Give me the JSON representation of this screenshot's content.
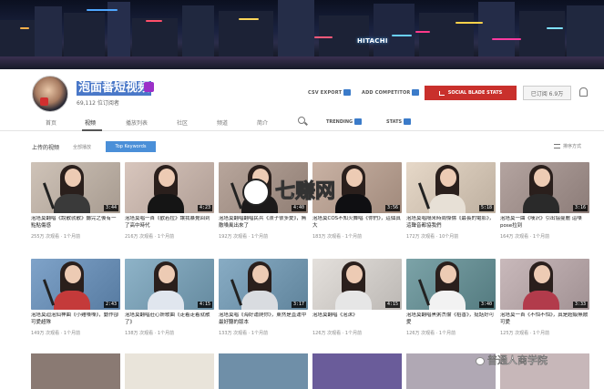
{
  "channel": {
    "name": "泡面番短视频",
    "subscribers": "69,112 位订阅者"
  },
  "header": {
    "csv_export": "CSV EXPORT",
    "add_competitor": "ADD COMPETITOR",
    "social_blade": "SOCIAL BLADE STATS",
    "subscribed": "已订阅 6.9万"
  },
  "banner": {
    "neon_sign": "HITACHI"
  },
  "tabs": [
    "首页",
    "视频",
    "播放列表",
    "社区",
    "频道",
    "简介",
    "TRENDING",
    "STATS"
  ],
  "section": {
    "title": "上传的视频",
    "play_all": "全部播放",
    "top_keywords": "Top Keywords",
    "sort": "排序方式"
  },
  "videos": [
    {
      "title": "泡塔莫翻唱《說散就散》聽完之後有一點點傷感",
      "meta": "255万 次观看 · 1个月前",
      "duration": "3:44"
    },
    {
      "title": "泡塔莫唱一首《歡若拉》讓我暴覺回到了高中時代",
      "meta": "216万 次观看 · 1个月前",
      "duration": "4:23"
    },
    {
      "title": "泡塔莫翻唱翻唱民兵《浪子很多愛》，無敵嗓風出來了",
      "meta": "192万 次观看 · 1个月前",
      "duration": "4:40"
    },
    {
      "title": "泡塔莫COS不知火舞唱《你們》，這個真大",
      "meta": "183万 次观看 · 1个月前",
      "duration": "3:56"
    },
    {
      "title": "泡塔莫唱隔米時周傑倫《最長的電影》，這聲音都協我們",
      "meta": "172万 次观看 · 10个月前",
      "duration": "5:18"
    },
    {
      "title": "泡塔莫一曲《嘆沢》引出協曼麗 這嗓pose拉到",
      "meta": "164万 次观看 · 1个月前",
      "duration": "3:16"
    },
    {
      "title": "泡塔莫迴泡仙神曲《小雞嗓嗓》，動作卻可愛超隊",
      "meta": "149万 次观看 · 1个月前",
      "duration": "2:43"
    },
    {
      "title": "泡塔莫翻唱莊心妍歌曲《走着走着就散了》",
      "meta": "138万 次观看 · 1个月前",
      "duration": "4:15"
    },
    {
      "title": "泡塔莫唱《海好運爬你》，東然是直運中最好聽的版本",
      "meta": "133万 次观看 · 1个月前",
      "duration": "3:17"
    },
    {
      "title": "泡塔莫翻唱《泡沫》",
      "meta": "126万 次观看 · 1个月前",
      "duration": "4:15"
    },
    {
      "title": "泡塔莫翻唱黑粥杰倫《稻香》，挺話好可愛",
      "meta": "126万 次观看 · 1个月前",
      "duration": "3:40"
    },
    {
      "title": "泡塔莫一首《不怕不怕》，真是超級無敵可愛",
      "meta": "125万 次观看 · 1个月前",
      "duration": "3:33"
    }
  ],
  "watermark": {
    "site": "七赚网",
    "footer": "普通人商学院"
  }
}
